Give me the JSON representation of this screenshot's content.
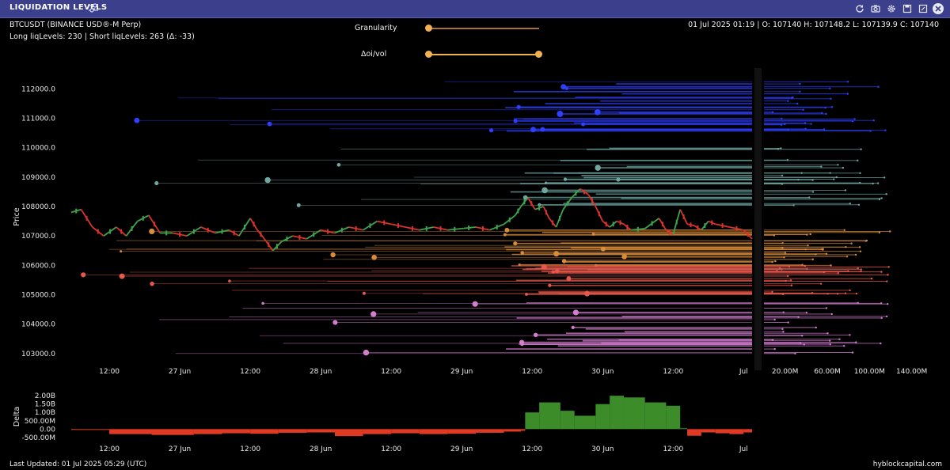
{
  "window": {
    "title": "LIQUIDATION LEVELS",
    "icons": [
      "settings-sliders-icon",
      "refresh-icon",
      "camera-icon",
      "gear-icon",
      "save-icon",
      "expand-icon",
      "close-icon"
    ]
  },
  "header": {
    "symbol": "BTCUSDT (BINANCE USD®-M Perp)",
    "levels_summary": "Long liqLevels: 230 | Short liqLevels: 263 (Δ: -33)",
    "ohlc": "01 Jul 2025 01:19 | O: 107140 H: 107148.2 L: 107139.9 C: 107140"
  },
  "controls": {
    "granularity_label": "Granularity",
    "granularity_value": 0.0,
    "oi_vol_label": "Δoi/vol",
    "oi_vol_range": [
      0.0,
      1.0
    ]
  },
  "footer": {
    "last_updated": "Last Updated: 01 Jul 2025 05:29 (UTC)",
    "brand": "hyblockcapital.com"
  },
  "colors": {
    "background": "#000000",
    "titlebar": "#3b3f8c",
    "candle_up": "#3fa34d",
    "candle_down": "#d9342b",
    "delta_pos": "#3c8c2a",
    "delta_neg": "#e03a24",
    "slider": "#f2b24f"
  },
  "chart_data": [
    {
      "type": "line",
      "name": "price-liquidation-chart",
      "ylabel": "Price",
      "y_ticks": [
        "112000.0",
        "111000.0",
        "110000.0",
        "109000.0",
        "108000.0",
        "107000.0",
        "106000.0",
        "105000.0",
        "104000.0",
        "103000.0"
      ],
      "y_tick_values": [
        112000,
        111000,
        110000,
        109000,
        108000,
        107000,
        106000,
        105000,
        104000,
        103000
      ],
      "x_ticks": [
        "12:00",
        "27 Jun",
        "12:00",
        "28 Jun",
        "12:00",
        "29 Jun",
        "12:00",
        "30 Jun",
        "12:00",
        "Jul"
      ],
      "x_tick_values": [
        0.5,
        1,
        1.5,
        2,
        2.5,
        3,
        3.5,
        4,
        4.5,
        5
      ],
      "ylim": [
        102700,
        112600
      ],
      "xlim": [
        0.23,
        5.06
      ],
      "price_x": [
        0.23,
        0.3,
        0.38,
        0.46,
        0.55,
        0.62,
        0.7,
        0.78,
        0.86,
        0.95,
        1.05,
        1.15,
        1.25,
        1.35,
        1.42,
        1.5,
        1.55,
        1.6,
        1.66,
        1.72,
        1.8,
        1.9,
        2.0,
        2.1,
        2.2,
        2.3,
        2.4,
        2.5,
        2.6,
        2.7,
        2.8,
        2.9,
        3.0,
        3.1,
        3.2,
        3.3,
        3.38,
        3.42,
        3.47,
        3.52,
        3.58,
        3.62,
        3.67,
        3.72,
        3.78,
        3.84,
        3.9,
        3.95,
        4.0,
        4.05,
        4.1,
        4.15,
        4.2,
        4.3,
        4.4,
        4.45,
        4.5,
        4.55,
        4.6,
        4.65,
        4.7,
        4.75,
        4.8,
        4.9,
        5.0,
        5.06
      ],
      "price_y": [
        107800,
        107900,
        107300,
        107000,
        107300,
        107000,
        107500,
        107700,
        107100,
        107100,
        107000,
        107300,
        107100,
        107200,
        107000,
        107600,
        107200,
        106900,
        106500,
        106800,
        107000,
        106900,
        107200,
        107100,
        107300,
        107200,
        107500,
        107400,
        107300,
        107200,
        107300,
        107200,
        107250,
        107300,
        107200,
        107400,
        107700,
        108000,
        108300,
        107900,
        108000,
        107600,
        107300,
        107900,
        108300,
        108600,
        108400,
        108000,
        107500,
        107300,
        107500,
        107400,
        107200,
        107250,
        107600,
        107200,
        107050,
        107900,
        107400,
        107350,
        107200,
        107500,
        107400,
        107300,
        107200,
        106900
      ],
      "long_level_bands": [
        {
          "color": "#2f3fff",
          "price_from": 110500,
          "price_to": 112300
        },
        {
          "color": "#6fa7a3",
          "price_from": 108000,
          "price_to": 110000
        },
        {
          "color": "#d98c3a",
          "price_from": 106000,
          "price_to": 107200
        },
        {
          "color": "#e5584b",
          "price_from": 104900,
          "price_to": 106000
        },
        {
          "color": "#d37ed0",
          "price_from": 102800,
          "price_to": 104800
        }
      ],
      "side_histogram_ticks": [
        "20.00M",
        "60.00M",
        "100.00M",
        "140.00M"
      ],
      "side_histogram_tick_values": [
        20,
        60,
        100,
        140
      ]
    },
    {
      "type": "bar",
      "name": "delta",
      "ylabel": "Delta",
      "y_ticks": [
        "2.00B",
        "1.50B",
        "1.00B",
        "500.00M",
        "0.00",
        "-500.00M"
      ],
      "y_tick_values": [
        2.0,
        1.5,
        1.0,
        0.5,
        0.0,
        -0.5
      ],
      "ylim": [
        -0.65,
        2.15
      ],
      "x": [
        0.23,
        0.5,
        0.8,
        1.1,
        1.3,
        1.5,
        1.7,
        1.9,
        2.1,
        2.3,
        2.5,
        2.7,
        2.9,
        3.1,
        3.3,
        3.42,
        3.45,
        3.55,
        3.7,
        3.8,
        3.95,
        4.05,
        4.15,
        4.3,
        4.45,
        4.55,
        4.6,
        4.7,
        4.8,
        4.9,
        5.0,
        5.06
      ],
      "values": [
        -0.05,
        -0.3,
        -0.35,
        -0.3,
        -0.25,
        -0.28,
        -0.22,
        -0.2,
        -0.42,
        -0.3,
        -0.25,
        -0.3,
        -0.28,
        -0.22,
        -0.15,
        -0.1,
        1.0,
        1.6,
        1.1,
        0.8,
        1.5,
        2.0,
        1.9,
        1.6,
        1.4,
        0.05,
        -0.4,
        -0.2,
        -0.25,
        -0.3,
        -0.2,
        -0.4
      ]
    }
  ]
}
